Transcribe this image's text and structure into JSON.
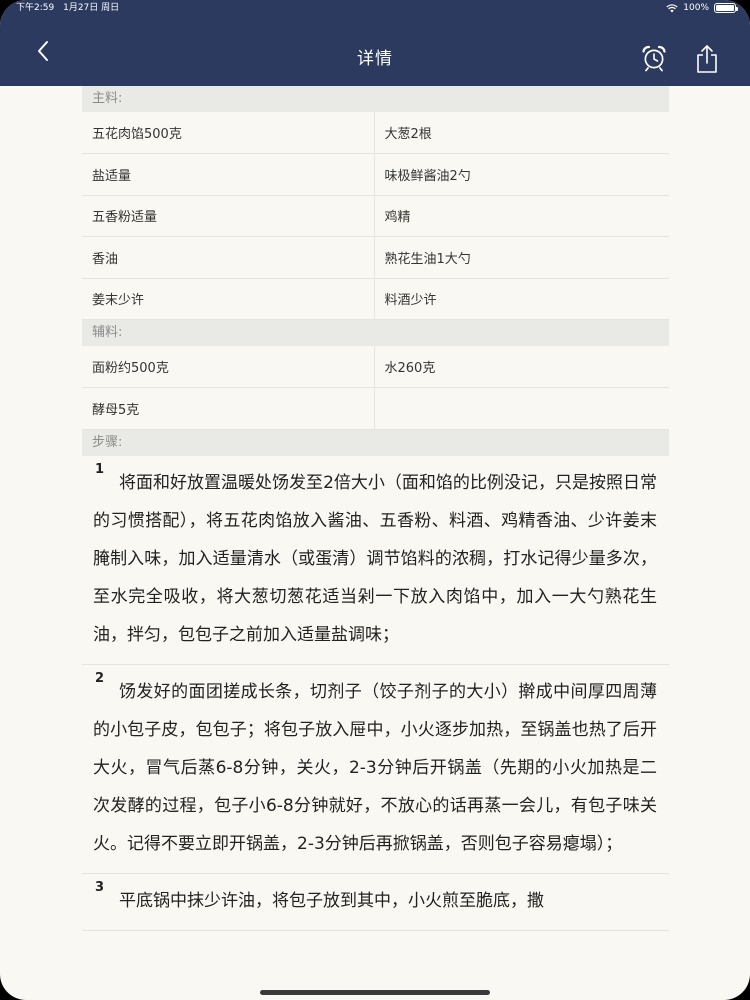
{
  "status_bar": {
    "time": "下午2:59",
    "date": "1月27日 周日",
    "battery": "100%",
    "battery_level": 1.0
  },
  "nav": {
    "title": "详情",
    "back_icon": "chevron-left-icon",
    "alarm_icon": "alarm-clock-icon",
    "share_icon": "share-icon"
  },
  "main_ingredients": {
    "header": "主料:",
    "rows": [
      [
        "五花肉馅500克",
        "大葱2根"
      ],
      [
        "盐适量",
        "味极鲜酱油2勺"
      ],
      [
        "五香粉适量",
        "鸡精"
      ],
      [
        "香油",
        "熟花生油1大勺"
      ],
      [
        "姜末少许",
        "料酒少许"
      ]
    ]
  },
  "auxiliary_ingredients": {
    "header": "辅料:",
    "rows": [
      [
        "面粉约500克",
        "水260克"
      ],
      [
        "酵母5克",
        ""
      ]
    ]
  },
  "steps": {
    "header": "步骤:",
    "items": [
      {
        "number": "1",
        "text": "将面和好放置温暖处饧发至2倍大小（面和馅的比例没记，只是按照日常的习惯搭配），将五花肉馅放入酱油、五香粉、料酒、鸡精香油、少许姜末腌制入味，加入适量清水（或蛋清）调节馅料的浓稠，打水记得少量多次，至水完全吸收，将大葱切葱花适当剁一下放入肉馅中，加入一大勺熟花生油，拌匀，包包子之前加入适量盐调味；"
      },
      {
        "number": "2",
        "text": "饧发好的面团搓成长条，切剂子（饺子剂子的大小）擀成中间厚四周薄的小包子皮，包包子；将包子放入屉中，小火逐步加热，至锅盖也热了后开大火，冒气后蒸6-8分钟，关火，2-3分钟后开锅盖（先期的小火加热是二次发酵的过程，包子小6-8分钟就好，不放心的话再蒸一会儿，有包子味关火。记得不要立即开锅盖，2-3分钟后再掀锅盖，否则包子容易瘪塌）；"
      },
      {
        "number": "3",
        "text": "平底锅中抹少许油，将包子放到其中，小火煎至脆底，撒"
      }
    ]
  },
  "colors": {
    "nav_background": "#2b3a5e",
    "page_background": "#faf8f2",
    "section_header_background": "#e9e9e6"
  }
}
